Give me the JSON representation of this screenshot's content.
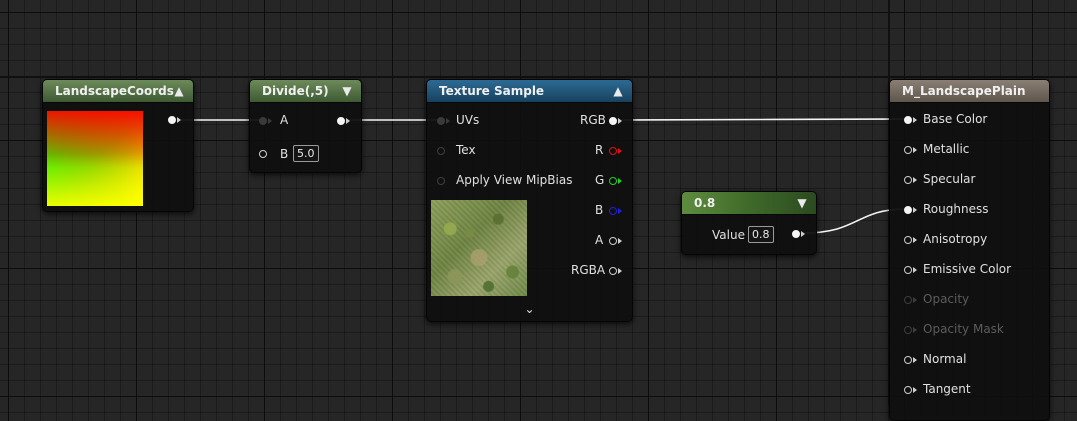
{
  "nodes": {
    "landscape_coords": {
      "title": "LandscapeCoords",
      "collapse_icon": "chevron-up-icon"
    },
    "divide": {
      "title": "Divide(,5)",
      "collapse_icon": "chevron-down-icon",
      "inputs": [
        {
          "label": "A"
        },
        {
          "label": "B",
          "value": "5.0"
        }
      ]
    },
    "texture_sample": {
      "title": "Texture Sample",
      "collapse_icon": "chevron-up-icon",
      "inputs": [
        {
          "label": "UVs"
        },
        {
          "label": "Tex"
        },
        {
          "label": "Apply View MipBias"
        }
      ],
      "outputs": [
        {
          "label": "RGB",
          "color": "#f4f4f4"
        },
        {
          "label": "R",
          "color": "#e01010"
        },
        {
          "label": "G",
          "color": "#20d020"
        },
        {
          "label": "B",
          "color": "#2020e0"
        },
        {
          "label": "A",
          "color": "#cfcfcf"
        },
        {
          "label": "RGBA",
          "color": "#cfcfcf"
        }
      ],
      "expand_icon": "chevron-down-icon"
    },
    "constant": {
      "title": "0.8",
      "collapse_icon": "chevron-down-icon",
      "value_label": "Value",
      "value": "0.8"
    },
    "material_result": {
      "title": "M_LandscapePlain",
      "inputs": [
        {
          "label": "Base Color",
          "connected": true,
          "enabled": true
        },
        {
          "label": "Metallic",
          "connected": false,
          "enabled": true
        },
        {
          "label": "Specular",
          "connected": false,
          "enabled": true
        },
        {
          "label": "Roughness",
          "connected": true,
          "enabled": true
        },
        {
          "label": "Anisotropy",
          "connected": false,
          "enabled": true
        },
        {
          "label": "Emissive Color",
          "connected": false,
          "enabled": true
        },
        {
          "label": "Opacity",
          "connected": false,
          "enabled": false
        },
        {
          "label": "Opacity Mask",
          "connected": false,
          "enabled": false
        },
        {
          "label": "Normal",
          "connected": false,
          "enabled": true
        },
        {
          "label": "Tangent",
          "connected": false,
          "enabled": true
        }
      ]
    }
  },
  "colors": {
    "graph_background": "#262626",
    "wire": "#f4f4f4",
    "header_math": "#4a6a3e",
    "header_texture": "#1f5578",
    "header_constant": "#4e7a34",
    "header_result": "#746a60"
  }
}
